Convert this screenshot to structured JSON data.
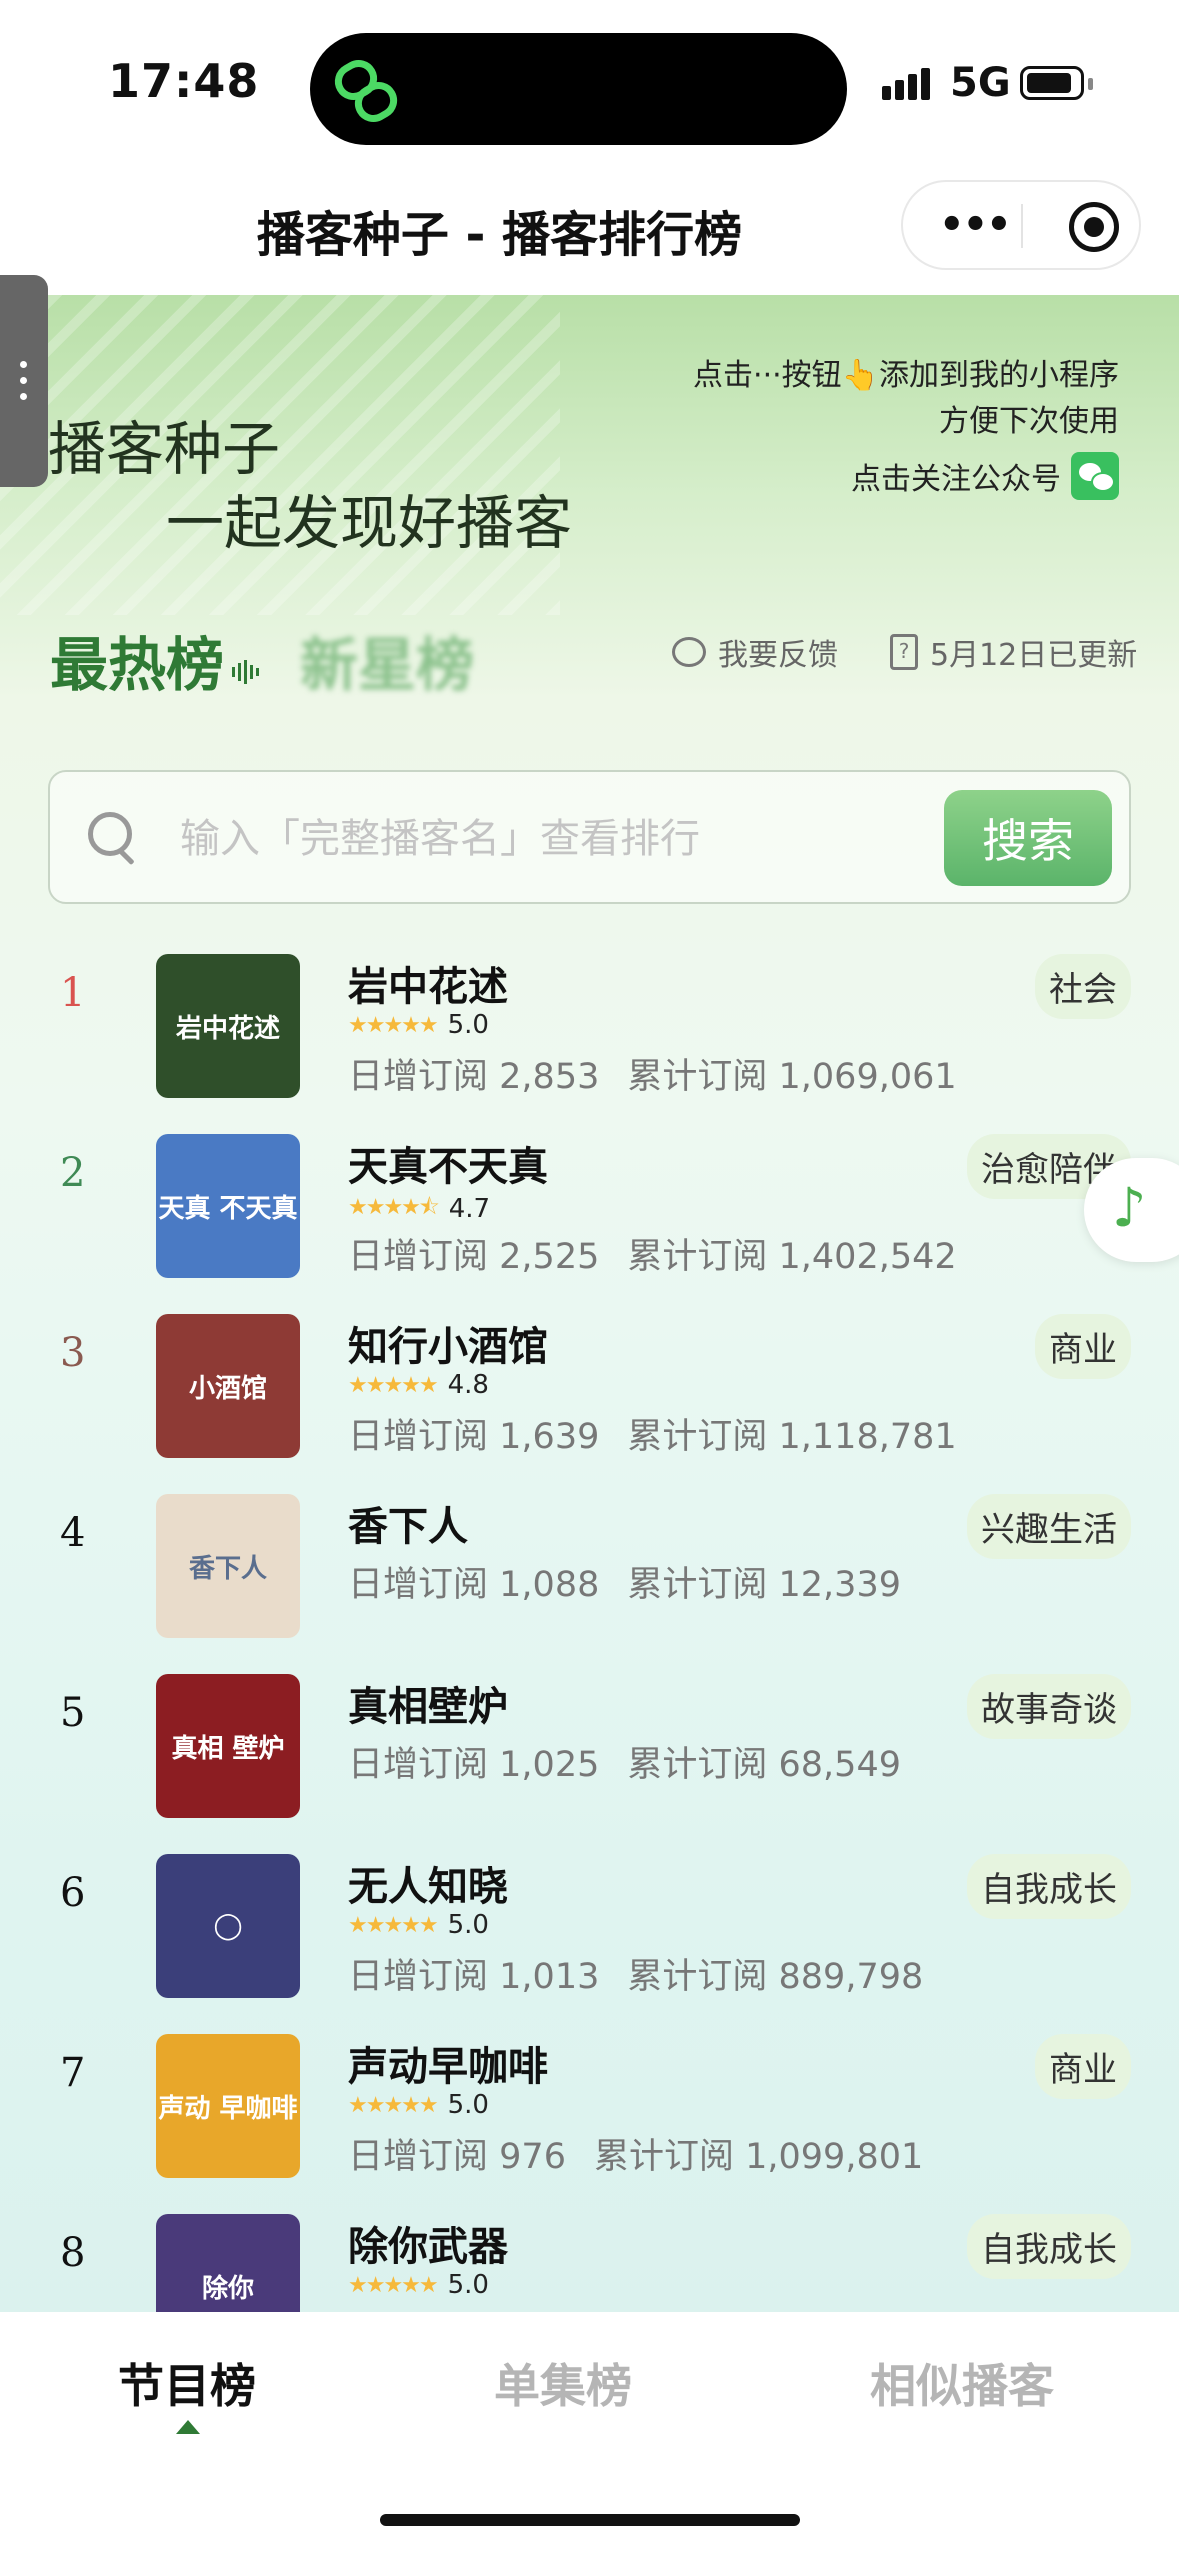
{
  "status_bar": {
    "time": "17:48",
    "network": "5G",
    "icons": [
      "link-icon",
      "signal-icon",
      "battery-icon"
    ]
  },
  "nav": {
    "title": "播客种子 - 播客排行榜",
    "more_icon": "more-dots-icon",
    "close_icon": "target-icon"
  },
  "hero": {
    "slogan_line1": "播客种子",
    "slogan_line2": "一起发现好播客",
    "tip_line1": "点击···按钮👆添加到我的小程序",
    "tip_line2": "方便下次使用",
    "follow_text": "点击关注公众号",
    "follow_icon": "wechat-icon"
  },
  "tabs": {
    "hot": "最热榜",
    "new": "新星榜",
    "feedback": "我要反馈",
    "updated": "5月12日已更新"
  },
  "search": {
    "placeholder": "输入「完整播客名」查看排行",
    "value": "",
    "button_label": "搜索"
  },
  "labels": {
    "daily": "日增订阅",
    "total": "累计订阅"
  },
  "rank_colors": [
    "#d9534f",
    "#3f8a55",
    "#8a5a50",
    "#111111",
    "#111111",
    "#111111",
    "#111111",
    "#111111"
  ],
  "rankings": [
    {
      "rank": "1",
      "name": "岩中花述",
      "rating": "5.0",
      "stars": 5,
      "daily": "2,853",
      "total": "1,069,061",
      "category": "社会",
      "cover_text": "岩中花述",
      "cover_color": "#2f4f2a"
    },
    {
      "rank": "2",
      "name": "天真不天真",
      "rating": "4.7",
      "stars": 4.5,
      "daily": "2,525",
      "total": "1,402,542",
      "category": "治愈陪伴",
      "cover_text": "天真 不天真",
      "cover_color": "#4a7ac4"
    },
    {
      "rank": "3",
      "name": "知行小酒馆",
      "rating": "4.8",
      "stars": 5,
      "daily": "1,639",
      "total": "1,118,781",
      "category": "商业",
      "cover_text": "小酒馆",
      "cover_color": "#8e3a35"
    },
    {
      "rank": "4",
      "name": "香下人",
      "rating": "",
      "stars": 0,
      "daily": "1,088",
      "total": "12,339",
      "category": "兴趣生活",
      "cover_text": "香下人",
      "cover_color": "#e9dccb"
    },
    {
      "rank": "5",
      "name": "真相壁炉",
      "rating": "",
      "stars": 0,
      "daily": "1,025",
      "total": "68,549",
      "category": "故事奇谈",
      "cover_text": "真相 壁炉",
      "cover_color": "#8c1d22"
    },
    {
      "rank": "6",
      "name": "无人知晓",
      "rating": "5.0",
      "stars": 5,
      "daily": "1,013",
      "total": "889,798",
      "category": "自我成长",
      "cover_text": "◯",
      "cover_color": "#3b3f7a"
    },
    {
      "rank": "7",
      "name": "声动早咖啡",
      "rating": "5.0",
      "stars": 5,
      "daily": "976",
      "total": "1,099,801",
      "category": "商业",
      "cover_text": "声动 早咖啡",
      "cover_color": "#e8a72a"
    },
    {
      "rank": "8",
      "name": "除你武器",
      "rating": "5.0",
      "stars": 5,
      "daily": "",
      "total": "",
      "category": "自我成长",
      "cover_text": "除你",
      "cover_color": "#4a3a7a"
    }
  ],
  "floating": {
    "music_icon": "music-note-icon"
  },
  "bottom_tabs": {
    "tab1": "节目榜",
    "tab2": "单集榜",
    "tab3": "相似播客"
  }
}
